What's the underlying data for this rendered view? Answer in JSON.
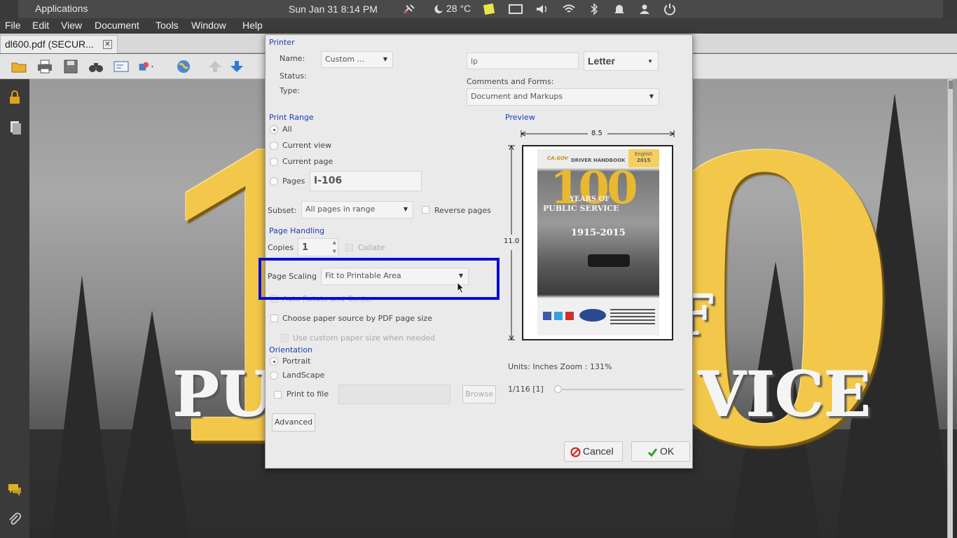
{
  "topbar": {
    "applications": "Applications",
    "clock": "Sun Jan 31  8:14 PM",
    "weather": "28 °C",
    "icons": [
      "satellite-icon",
      "weather-moon-icon",
      "sticky-note-icon",
      "screen-icon",
      "volume-icon",
      "wifi-icon",
      "bluetooth-icon",
      "bell-icon",
      "user-icon",
      "power-icon"
    ]
  },
  "menubar": {
    "items": [
      "File",
      "Edit",
      "View",
      "Document",
      "Tools",
      "Window",
      "Help"
    ]
  },
  "tab": {
    "label": "dl600.pdf (SECUR...",
    "close": "✕"
  },
  "toolbar": {
    "icons": [
      "open-folder-icon",
      "print-icon",
      "save-icon",
      "binoculars-icon",
      "email-icon",
      "share-icon",
      "globe-icon",
      "up-arrow-icon",
      "down-arrow-icon"
    ]
  },
  "document": {
    "big_number": "100",
    "line1": "PU",
    "line2": "VICE",
    "fragment": "F"
  },
  "dialog": {
    "printer": {
      "heading": "Printer",
      "name_label": "Name:",
      "name_value": "Custom ...",
      "status_label": "Status:",
      "type_label": "Type:",
      "printer_input": "lp",
      "paper_size": "Letter",
      "comments_label": "Comments and Forms:",
      "comments_value": "Document and Markups"
    },
    "range": {
      "heading": "Print Range",
      "all": "All",
      "current_view": "Current view",
      "current_page": "Current page",
      "pages": "Pages",
      "pages_value": "I-106",
      "subset_label": "Subset:",
      "subset_value": "All pages in range",
      "reverse": "Reverse pages"
    },
    "handling": {
      "heading": "Page Handling",
      "copies_label": "Copies",
      "copies_value": "1",
      "collate": "Collate",
      "scaling_label": "Page Scaling",
      "scaling_value": "Fit to Printable Area",
      "auto_rotate": "Auto Rotate and Center",
      "paper_source": "Choose paper source by PDF page size",
      "custom_paper": "Use custom paper size when needed"
    },
    "orientation": {
      "heading": "Orientation",
      "portrait": "Portrait",
      "landscape": "LandScape"
    },
    "print_to_file": "Print to file",
    "browse": "Browse",
    "advanced": "Advanced",
    "preview": {
      "heading": "Preview",
      "width": "8.5",
      "height": "11.0",
      "units": "Units: Inches Zoom : 131%",
      "page_info": "1/116  [1]",
      "cover": {
        "logo": "CA.GOV",
        "handbook": "DRIVER HANDBOOK",
        "lang": "English",
        "year": "2015",
        "big": "100",
        "years_of": "YEARS OF",
        "public_service": "PUBLIC SERVICE",
        "span": "1915-2015"
      }
    },
    "cancel": "Cancel",
    "ok": "OK"
  },
  "colors": {
    "highlight": "#0a0ad8",
    "section": "#1a3ab8",
    "gold": "#f3c74a"
  }
}
